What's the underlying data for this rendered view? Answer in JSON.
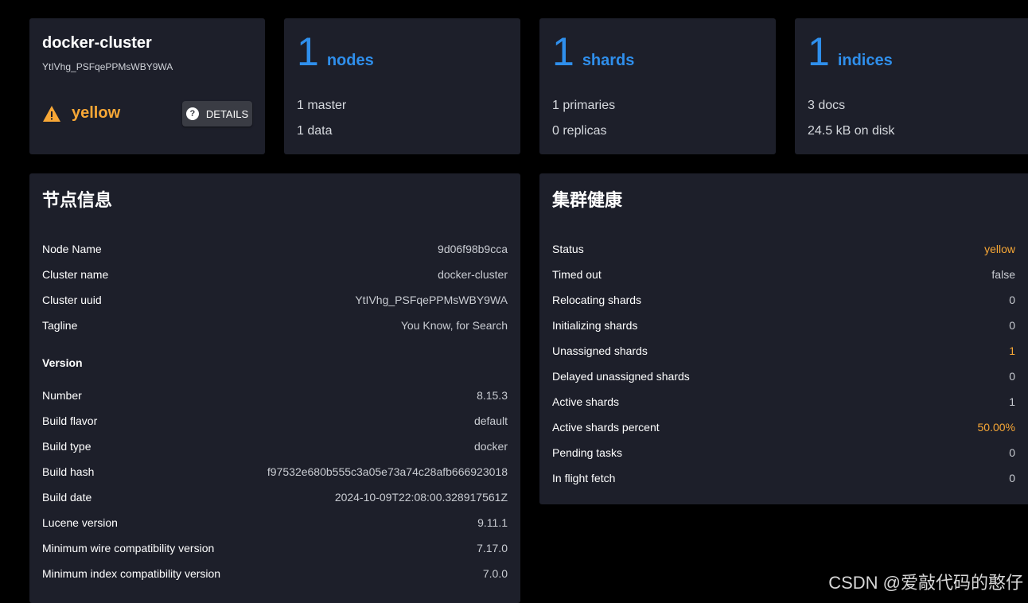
{
  "cluster": {
    "name": "docker-cluster",
    "uuid": "YtIVhg_PSFqePPMsWBY9WA",
    "status": "yellow",
    "details_label": "DETAILS"
  },
  "nodes": {
    "count": "1",
    "label": "nodes",
    "line1": "1 master",
    "line2": "1 data"
  },
  "shards": {
    "count": "1",
    "label": "shards",
    "line1": "1 primaries",
    "line2": "0 replicas"
  },
  "indices": {
    "count": "1",
    "label": "indices",
    "line1": "3 docs",
    "line2": "24.5 kB on disk"
  },
  "node_info": {
    "title": "节点信息",
    "rows": [
      {
        "key": "Node Name",
        "value": "9d06f98b9cca"
      },
      {
        "key": "Cluster name",
        "value": "docker-cluster"
      },
      {
        "key": "Cluster uuid",
        "value": "YtIVhg_PSFqePPMsWBY9WA"
      },
      {
        "key": "Tagline",
        "value": "You Know, for Search"
      }
    ],
    "version_label": "Version",
    "version_rows": [
      {
        "key": "Number",
        "value": "8.15.3"
      },
      {
        "key": "Build flavor",
        "value": "default"
      },
      {
        "key": "Build type",
        "value": "docker"
      },
      {
        "key": "Build hash",
        "value": "f97532e680b555c3a05e73a74c28afb666923018"
      },
      {
        "key": "Build date",
        "value": "2024-10-09T22:08:00.328917561Z"
      },
      {
        "key": "Lucene version",
        "value": "9.11.1"
      },
      {
        "key": "Minimum wire compatibility version",
        "value": "7.17.0"
      },
      {
        "key": "Minimum index compatibility version",
        "value": "7.0.0"
      }
    ]
  },
  "health": {
    "title": "集群健康",
    "rows": [
      {
        "key": "Status",
        "value": "yellow",
        "warn": true
      },
      {
        "key": "Timed out",
        "value": "false"
      },
      {
        "key": "Relocating shards",
        "value": "0"
      },
      {
        "key": "Initializing shards",
        "value": "0"
      },
      {
        "key": "Unassigned shards",
        "value": "1",
        "warn": true
      },
      {
        "key": "Delayed unassigned shards",
        "value": "0"
      },
      {
        "key": "Active shards",
        "value": "1"
      },
      {
        "key": "Active shards percent",
        "value": "50.00%",
        "warn": true
      },
      {
        "key": "Pending tasks",
        "value": "0"
      },
      {
        "key": "In flight fetch",
        "value": "0"
      }
    ]
  },
  "watermark": "CSDN @爱敲代码的憨仔",
  "colors": {
    "accent": "#2f8fec",
    "warning": "#f7a736",
    "card_bg": "#1d1f2a"
  }
}
